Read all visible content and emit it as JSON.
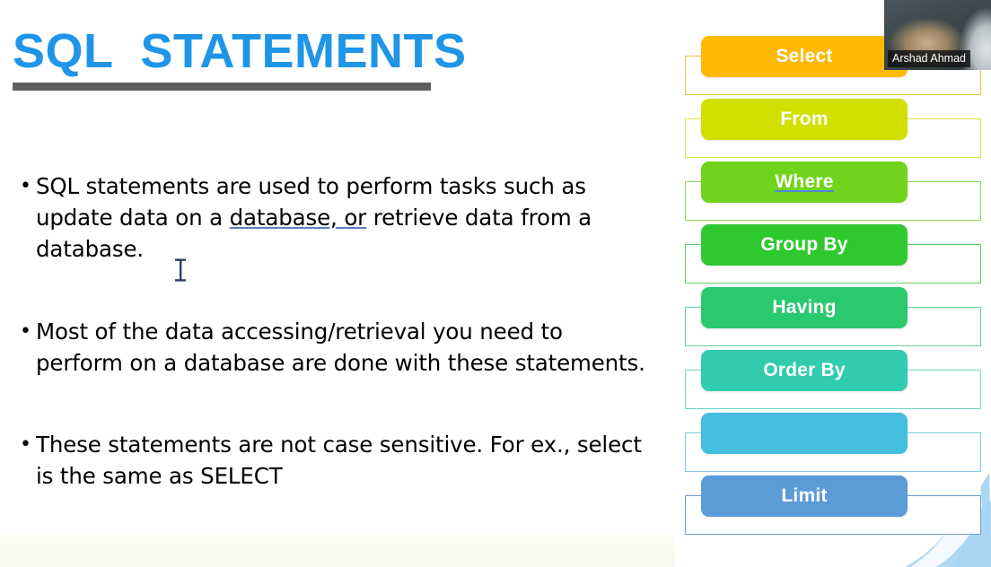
{
  "slide": {
    "title": "SQL  STATEMENTS",
    "title_color": "#1E95E6",
    "rule_color": "#5e5e5e",
    "background_color": "#ffffff",
    "bullets": [
      {
        "marker": "•",
        "text_before": "SQL statements are used to perform tasks such as update data on a ",
        "link_text": "database, or",
        "text_after": " retrieve data from a database."
      },
      {
        "marker": "•",
        "text_before": "Most of the data accessing/retrieval you need to perform on a database are done with these statements.",
        "link_text": "",
        "text_after": ""
      },
      {
        "marker": "•",
        "text_before": "These statements are not case sensitive. For ex., select is the same as SELECT",
        "link_text": "",
        "text_after": ""
      }
    ],
    "cursor": {
      "icon": "text-ibeam-cursor",
      "color": "#3b4a6b"
    }
  },
  "statement_list": {
    "items": [
      {
        "label": "Select",
        "color": "#FFB900",
        "outline_color": "#f0c23a",
        "is_link": false
      },
      {
        "label": "From",
        "color": "#D2E000",
        "outline_color": "#dbe24a",
        "is_link": false
      },
      {
        "label": "Where",
        "color": "#6FD41B",
        "outline_color": "#8ed95a",
        "is_link": true
      },
      {
        "label": "Group By",
        "color": "#2FC92F",
        "outline_color": "#63cf63",
        "is_link": false
      },
      {
        "label": "Having",
        "color": "#2BC96E",
        "outline_color": "#63d195",
        "is_link": false
      },
      {
        "label": "Order By",
        "color": "#31CCAE",
        "outline_color": "#6dd6c2",
        "is_link": false
      },
      {
        "label": "",
        "color": "#44BEDE",
        "outline_color": "#7ccde3",
        "is_link": false
      },
      {
        "label": "Limit",
        "color": "#5B9BD8",
        "outline_color": "#6d9fd1",
        "is_link": false
      }
    ]
  },
  "webcam": {
    "participant_name": "Arshad Ahmad"
  },
  "decoration": {
    "corner_swoosh_color": "#A8D4F2",
    "bottom_band_color": "#fbfbee"
  }
}
